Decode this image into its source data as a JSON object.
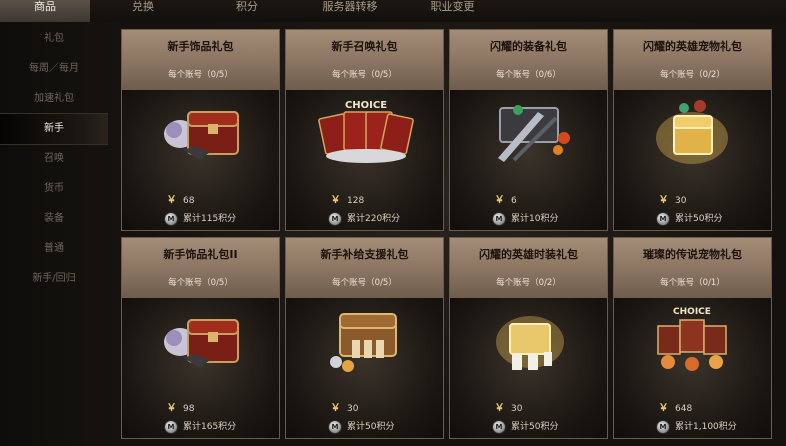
{
  "tabs": [
    {
      "label": "商品",
      "active": true
    },
    {
      "label": "兑换",
      "active": false
    },
    {
      "label": "积分",
      "active": false
    },
    {
      "label": "服务器转移",
      "active": false
    },
    {
      "label": "职业变更",
      "active": false
    }
  ],
  "sidebar": {
    "items": [
      {
        "label": "礼包"
      },
      {
        "label": "每周／每月"
      },
      {
        "label": "加速礼包"
      },
      {
        "label": "新手",
        "active": true
      },
      {
        "label": "召唤"
      },
      {
        "label": "货币"
      },
      {
        "label": "装备"
      },
      {
        "label": "普通"
      },
      {
        "label": "新手/回归"
      }
    ]
  },
  "products": [
    {
      "title": "新手饰品礼包",
      "limit": "每个账号（0/5）",
      "price": "68",
      "points": "累计115积分",
      "art": "chest-red"
    },
    {
      "title": "新手召唤礼包",
      "limit": "每个账号（0/5）",
      "price": "128",
      "points": "累计220积分",
      "art": "choice-cards",
      "art_label": "CHOICE"
    },
    {
      "title": "闪耀的装备礼包",
      "limit": "每个账号（0/6）",
      "price": "6",
      "points": "累计10积分",
      "art": "weapon-crate"
    },
    {
      "title": "闪耀的英雄宠物礼包",
      "limit": "每个账号（0/2）",
      "price": "30",
      "points": "累计50积分",
      "art": "golden-chest"
    },
    {
      "title": "新手饰品礼包II",
      "limit": "每个账号（0/5）",
      "price": "98",
      "points": "累计165积分",
      "art": "chest-red"
    },
    {
      "title": "新手补给支援礼包",
      "limit": "每个账号（0/5）",
      "price": "30",
      "points": "累计50积分",
      "art": "supply-chest"
    },
    {
      "title": "闪耀的英雄时装礼包",
      "limit": "每个账号（0/2）",
      "price": "30",
      "points": "累计50积分",
      "art": "costume-box"
    },
    {
      "title": "璀璨的传说宠物礼包",
      "limit": "每个账号（0/1）",
      "price": "648",
      "points": "累计1,100积分",
      "art": "choice-pets",
      "art_label": "CHOICE"
    }
  ],
  "currency_symbol": "￥",
  "points_icon": "coin-icon"
}
